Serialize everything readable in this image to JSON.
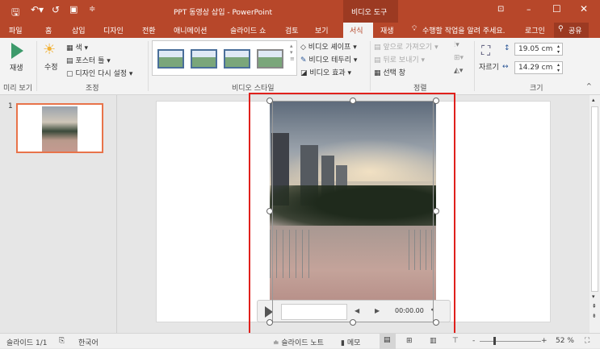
{
  "title_bar": {
    "title": "PPT 동영상 삽입 - PowerPoint",
    "context_tab": "비디오 도구",
    "icons": [
      "save-icon",
      "undo-icon",
      "redo-icon",
      "present-icon",
      "customize-icon"
    ],
    "window_buttons": [
      "ribbon-display-icon",
      "minimize-icon",
      "maximize-icon",
      "close-icon"
    ]
  },
  "tabs": [
    "파일",
    "홈",
    "삽입",
    "디자인",
    "전환",
    "애니메이션",
    "슬라이드 쇼",
    "검토",
    "보기",
    "서식",
    "재생"
  ],
  "active_tab": "서식",
  "tell_me": "수행할 작업을 알려 주세요.",
  "login": "로그인",
  "share": "공유",
  "ribbon": {
    "preview": {
      "play": "재생",
      "label": "미리 보기"
    },
    "adjust": {
      "corrections": "수정",
      "color": "색",
      "poster": "포스터 틀",
      "reset": "디자인 다시 설정",
      "label": "조정"
    },
    "styles": {
      "shape": "비디오 셰이프",
      "border": "비디오 테두리",
      "effects": "비디오 효과",
      "label": "비디오 스타일"
    },
    "arrange": {
      "forward": "앞으로 가져오기",
      "backward": "뒤로 보내기",
      "selection": "선택 창",
      "label": "정렬"
    },
    "size": {
      "crop": "자르기",
      "height": "19.05 cm",
      "width": "14.29 cm",
      "label": "크기"
    }
  },
  "slide_panel": {
    "slide_number": "1"
  },
  "video": {
    "time": "00:00.00"
  },
  "status": {
    "slide": "슬라이드 1/1",
    "language": "한국어",
    "notes": "슬라이드 노트",
    "comments": "메모",
    "zoom": "52 %",
    "zoom_level": 52
  },
  "colors": {
    "accent": "#b7472a",
    "selection": "#e0201c",
    "thumb_border": "#e8734a"
  }
}
